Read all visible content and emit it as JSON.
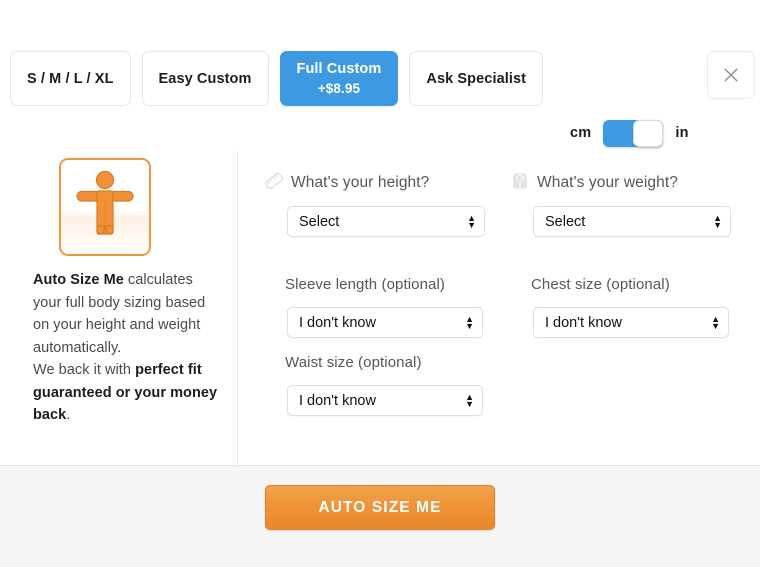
{
  "tabs": [
    {
      "label": "S / M / L / XL",
      "sub": "",
      "active": false
    },
    {
      "label": "Easy Custom",
      "sub": "",
      "active": false
    },
    {
      "label": "Full Custom",
      "sub": "+$8.95",
      "active": true
    },
    {
      "label": "Ask Specialist",
      "sub": "",
      "active": false
    }
  ],
  "close": {
    "icon": "close-icon"
  },
  "units": {
    "left_label": "cm",
    "right_label": "in",
    "selected": "cm"
  },
  "info": {
    "avatar_icon": "person-figure-icon",
    "brand": "Auto Size Me",
    "line1": " calculates your full body sizing based on your height and weight automatically.",
    "line2_prefix": "We back it with ",
    "line2_bold": "perfect fit guaranteed or your money back",
    "line2_suffix": "."
  },
  "form": {
    "height": {
      "icon": "ruler-icon",
      "label": "What's your height?",
      "value": "Select"
    },
    "weight": {
      "icon": "scale-icon",
      "label": "What's your weight?",
      "value": "Select"
    },
    "sleeve": {
      "label": "Sleeve length (optional)",
      "value": "I don't know"
    },
    "chest": {
      "label": "Chest size (optional)",
      "value": "I don't know"
    },
    "waist": {
      "label": "Waist size (optional)",
      "value": "I don't know"
    }
  },
  "cta": {
    "label": "AUTO SIZE ME"
  },
  "colors": {
    "accent_blue": "#3d9ae2",
    "accent_orange": "#ef9336",
    "avatar_orange": "#f0973c",
    "footer_bg": "#f5f5f5"
  }
}
